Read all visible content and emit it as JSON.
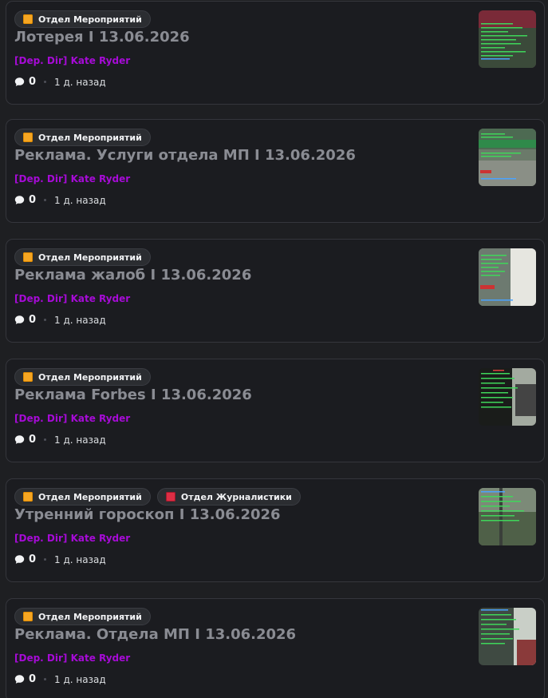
{
  "tags": {
    "events": "Отдел Мероприятий",
    "journalism": "Отдел Журналистики"
  },
  "posts": [
    {
      "title": "Лотерея I 13.06.2026",
      "author": "[Dep. Dir] Kate Ryder",
      "replies": "0",
      "time": "1 д. назад"
    },
    {
      "title": "Реклама. Услуги отдела МП I 13.06.2026",
      "author": "[Dep. Dir] Kate Ryder",
      "replies": "0",
      "time": "1 д. назад"
    },
    {
      "title": "Реклама жалоб I 13.06.2026",
      "author": "[Dep. Dir] Kate Ryder",
      "replies": "0",
      "time": "1 д. назад"
    },
    {
      "title": "Реклама Forbes I 13.06.2026",
      "author": "[Dep. Dir] Kate Ryder",
      "replies": "0",
      "time": "1 д. назад"
    },
    {
      "title": "Утренний гороскоп I 13.06.2026",
      "author": "[Dep. Dir] Kate Ryder",
      "replies": "0",
      "time": "1 д. назад"
    },
    {
      "title": "Реклама. Отдела МП I 13.06.2026",
      "author": "[Dep. Dir] Kate Ryder",
      "replies": "0",
      "time": "1 д. назад"
    }
  ],
  "icons": {
    "tag_events": "orange-square-emoji",
    "tag_journalism": "red-book-emoji",
    "replies": "speech-bubble-icon"
  },
  "colors": {
    "background": "#1e1f22",
    "card": "#1b1c20",
    "title": "#8a8c93",
    "author": "#a60bd6",
    "tag_bg": "#2b2d31"
  }
}
